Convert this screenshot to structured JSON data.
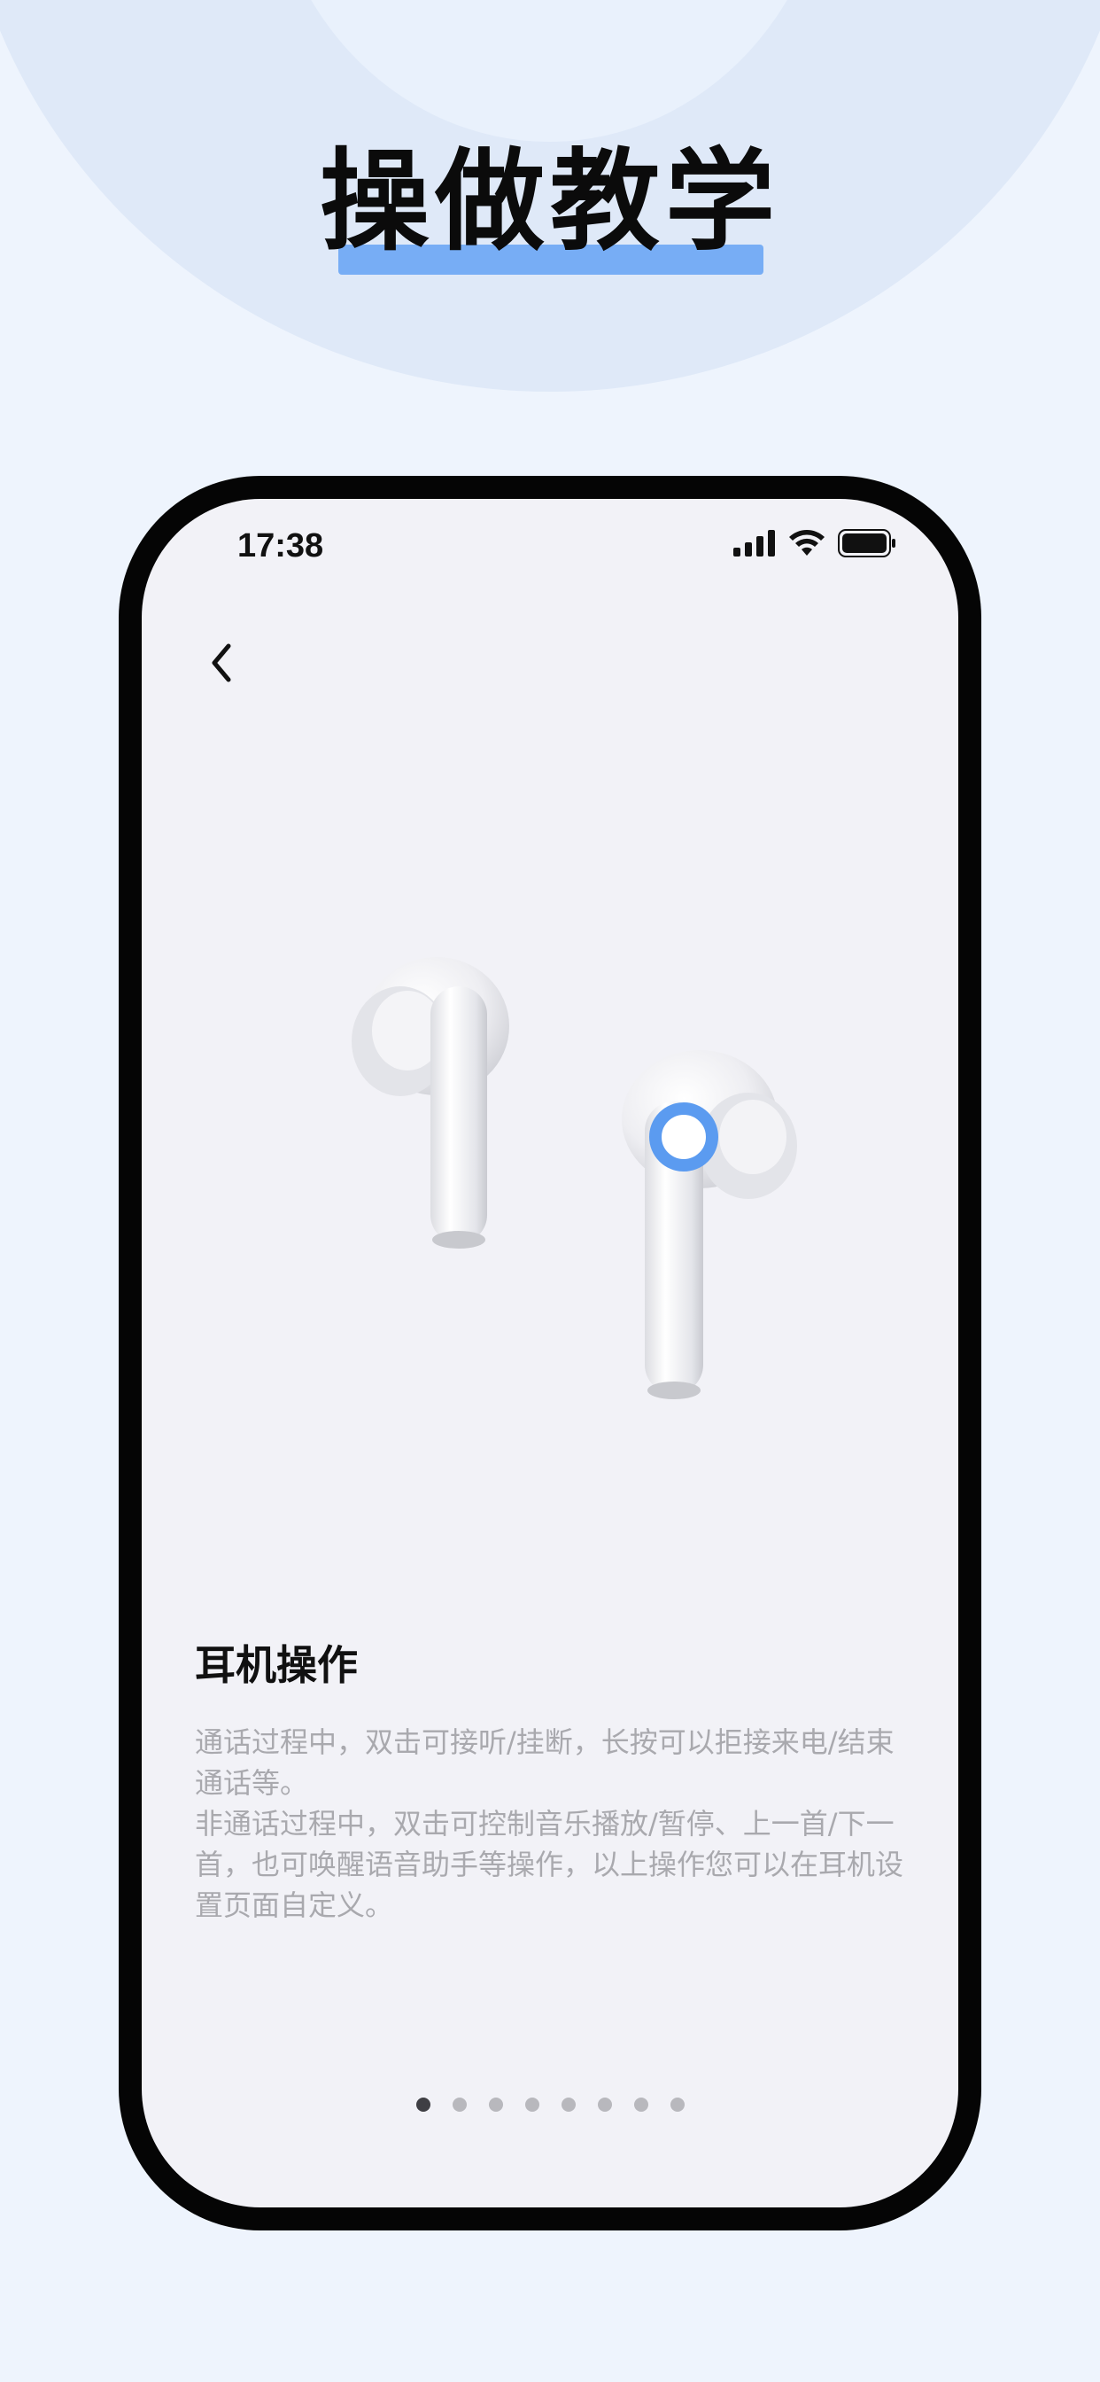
{
  "header": {
    "title": "操做教学"
  },
  "status_bar": {
    "time": "17:38"
  },
  "content": {
    "section_title": "耳机操作",
    "paragraph_1": "通话过程中，双击可接听/挂断，长按可以拒接来电/结束通话等。",
    "paragraph_2": "非通话过程中，双击可控制音乐播放/暂停、上一首/下一首，也可唤醒语音助手等操作，以上操作您可以在耳机设置页面自定义。"
  },
  "pagination": {
    "total": 8,
    "active_index": 0
  },
  "icons": {
    "back": "chevron-left-icon",
    "signal": "cellular-signal-icon",
    "wifi": "wifi-icon",
    "battery": "battery-icon",
    "touch_indicator": "touch-ring-icon"
  },
  "colors": {
    "accent": "#77adf5",
    "touch_ring": "#5b9bf0",
    "background": "#eef4fd"
  }
}
